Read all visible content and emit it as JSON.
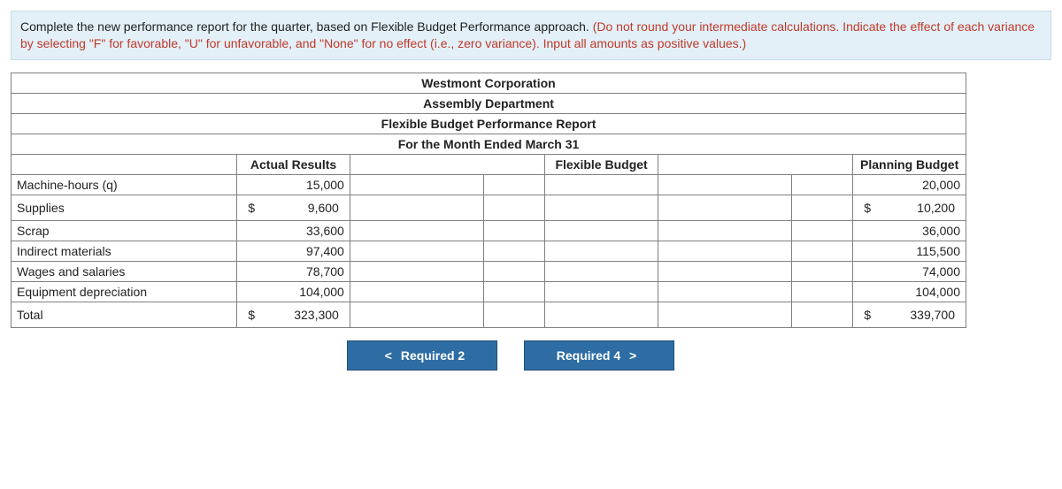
{
  "instructions": {
    "part1": "Complete the new performance report for the quarter, based on Flexible Budget Performance approach. ",
    "part2": "(Do not round your intermediate calculations. Indicate the effect of each variance by selecting \"F\" for favorable, \"U\" for unfavorable, and \"None\" for no effect (i.e., zero variance). Input all amounts as positive values.)"
  },
  "titles": {
    "t1": "Westmont Corporation",
    "t2": "Assembly Department",
    "t3": "Flexible Budget Performance Report",
    "t4": "For the Month Ended March 31"
  },
  "headers": {
    "actual": "Actual Results",
    "flexible": "Flexible Budget",
    "planning": "Planning Budget"
  },
  "rows": {
    "mh": {
      "label": "Machine-hours (q)",
      "actual_num": "15,000",
      "plan_num": "20,000"
    },
    "supplies": {
      "label": "Supplies",
      "actual_dollar": "9,600",
      "plan_dollar": "10,200"
    },
    "scrap": {
      "label": "Scrap",
      "actual_num": "33,600",
      "plan_num": "36,000"
    },
    "indmat": {
      "label": "Indirect materials",
      "actual_num": "97,400",
      "plan_num": "115,500"
    },
    "wages": {
      "label": "Wages and salaries",
      "actual_num": "78,700",
      "plan_num": "74,000"
    },
    "equip": {
      "label": "Equipment depreciation",
      "actual_num": "104,000",
      "plan_num": "104,000"
    },
    "total": {
      "label": "Total",
      "actual_total": "323,300",
      "plan_total": "339,700"
    }
  },
  "currency": "$",
  "nav": {
    "prev": "Required 2",
    "next": "Required 4",
    "chev_left": "<",
    "chev_right": ">"
  }
}
